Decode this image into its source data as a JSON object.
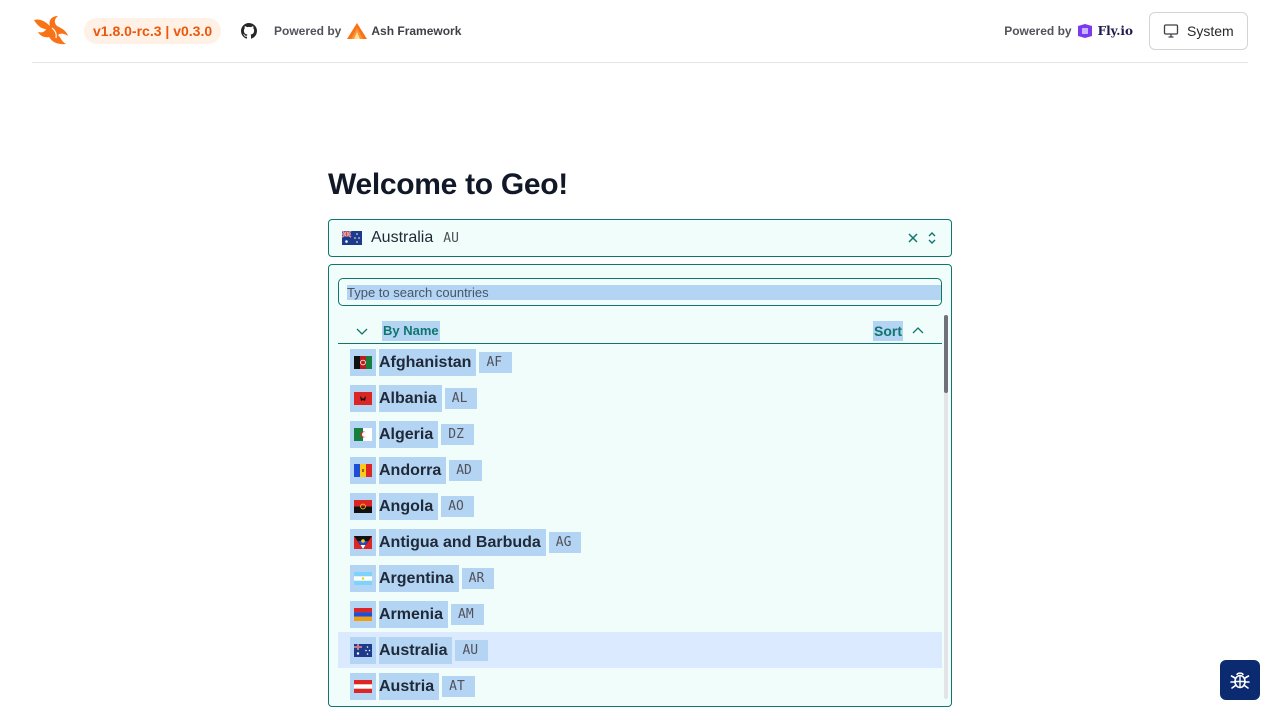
{
  "header": {
    "version": "v1.8.0-rc.3 | v0.3.0",
    "powered_by_label": "Powered by",
    "ash_name": "Ash Framework",
    "fly_name": "Fly.io",
    "system_label": "System",
    "icons": [
      "phoenix-logo-icon",
      "github-icon",
      "ash-logo-icon",
      "fly-logo-icon",
      "monitor-icon"
    ]
  },
  "main": {
    "title": "Welcome to Geo!",
    "selected": {
      "name": "Australia",
      "code": "AU"
    },
    "search_placeholder": "Type to search countries",
    "group_label": "By Name",
    "sort_label": "Sort"
  },
  "countries": [
    {
      "name": "Afghanistan",
      "code": "AF"
    },
    {
      "name": "Albania",
      "code": "AL"
    },
    {
      "name": "Algeria",
      "code": "DZ"
    },
    {
      "name": "Andorra",
      "code": "AD"
    },
    {
      "name": "Angola",
      "code": "AO"
    },
    {
      "name": "Antigua and Barbuda",
      "code": "AG"
    },
    {
      "name": "Argentina",
      "code": "AR"
    },
    {
      "name": "Armenia",
      "code": "AM"
    },
    {
      "name": "Australia",
      "code": "AU"
    },
    {
      "name": "Austria",
      "code": "AT"
    }
  ],
  "colors": {
    "accent": "#0f766e",
    "brand_orange": "#ea580c",
    "panel_bg": "#f0fdfa",
    "selection": "#b4d4f3",
    "active_row": "#dbeafe",
    "bug_button": "#0b2a6f"
  }
}
